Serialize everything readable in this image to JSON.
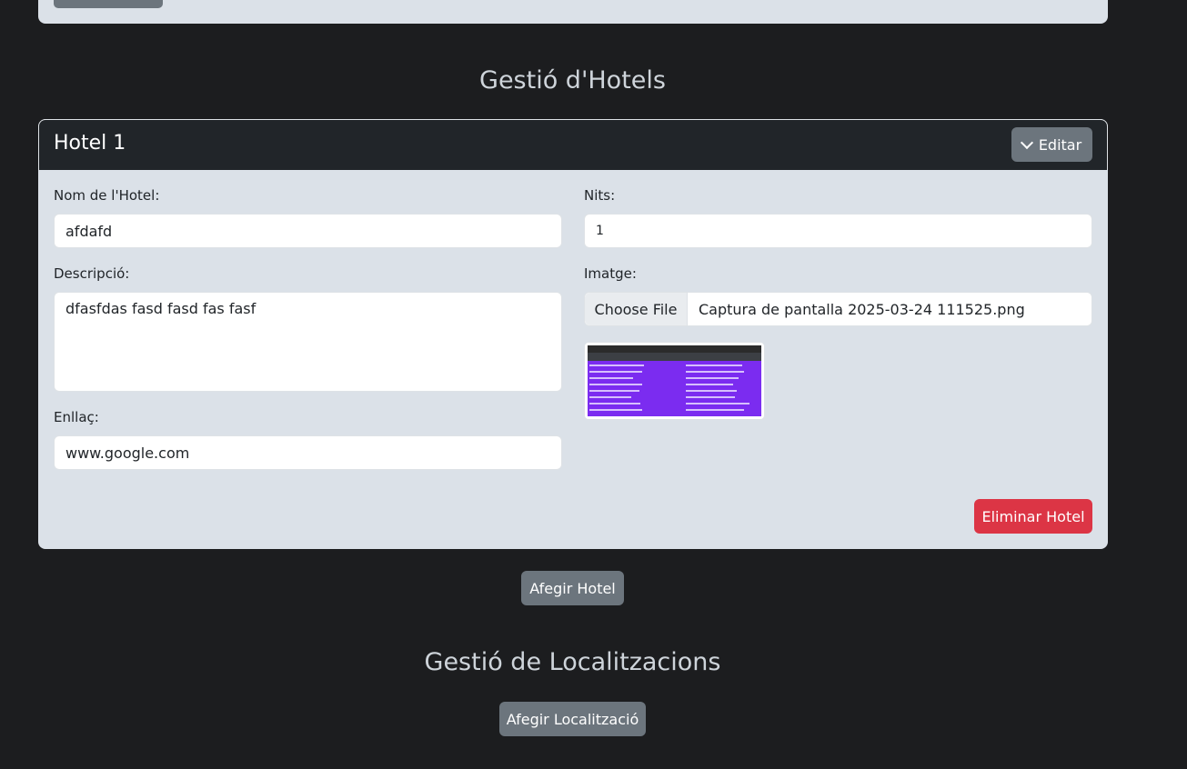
{
  "sections": {
    "hotels_title": "Gestió d'Hotels",
    "locations_title": "Gestió de Localitzacions"
  },
  "hotel": {
    "title": "Hotel 1",
    "edit_label": "Editar",
    "name_label": "Nom de l'Hotel:",
    "name_value": "afdafd",
    "nights_label": "Nits:",
    "nights_value": "1",
    "description_label": "Descripció:",
    "description_value": "dfasfdas fasd fasd fas fasf",
    "image_label": "Imatge:",
    "choose_file_label": "Choose File",
    "file_name": "Captura de pantalla 2025-03-24 111525.png",
    "link_label": "Enllaç:",
    "link_value": "www.google.com",
    "delete_label": "Eliminar Hotel"
  },
  "actions": {
    "add_hotel": "Afegir Hotel",
    "add_location": "Afegir Localització"
  },
  "colors": {
    "background": "#1c1d1f",
    "card": "#dbe1e8",
    "header": "#212529",
    "secondary": "#6c757d",
    "danger": "#dc3545"
  }
}
